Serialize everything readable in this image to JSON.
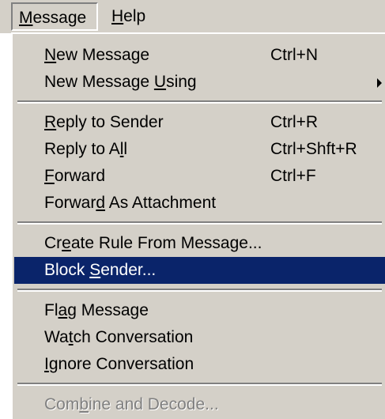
{
  "menubar": {
    "items": [
      {
        "label_before": "",
        "mnemonic": "M",
        "label_after": "essage"
      },
      {
        "label_before": "",
        "mnemonic": "H",
        "label_after": "elp"
      }
    ]
  },
  "menu": {
    "items": [
      {
        "before": "",
        "mnemonic": "N",
        "after": "ew Message",
        "shortcut": "Ctrl+N"
      },
      {
        "before": "New Message ",
        "mnemonic": "U",
        "after": "sing",
        "shortcut": ""
      },
      {
        "before": "",
        "mnemonic": "R",
        "after": "eply to Sender",
        "shortcut": "Ctrl+R"
      },
      {
        "before": "Reply to A",
        "mnemonic": "l",
        "after": "l",
        "shortcut": "Ctrl+Shft+R"
      },
      {
        "before": "",
        "mnemonic": "F",
        "after": "orward",
        "shortcut": "Ctrl+F"
      },
      {
        "before": "Forwar",
        "mnemonic": "d",
        "after": " As Attachment",
        "shortcut": ""
      },
      {
        "before": "Cr",
        "mnemonic": "e",
        "after": "ate Rule From Message...",
        "shortcut": ""
      },
      {
        "before": "Block ",
        "mnemonic": "S",
        "after": "ender...",
        "shortcut": ""
      },
      {
        "before": "Fl",
        "mnemonic": "a",
        "after": "g Message",
        "shortcut": ""
      },
      {
        "before": "Wa",
        "mnemonic": "t",
        "after": "ch Conversation",
        "shortcut": ""
      },
      {
        "before": "",
        "mnemonic": "I",
        "after": "gnore Conversation",
        "shortcut": ""
      },
      {
        "before": "Com",
        "mnemonic": "b",
        "after": "ine and Decode...",
        "shortcut": ""
      }
    ]
  },
  "colors": {
    "menu_background": "#d4d0c8",
    "highlight": "#0a246a",
    "disabled_text": "#808080"
  }
}
